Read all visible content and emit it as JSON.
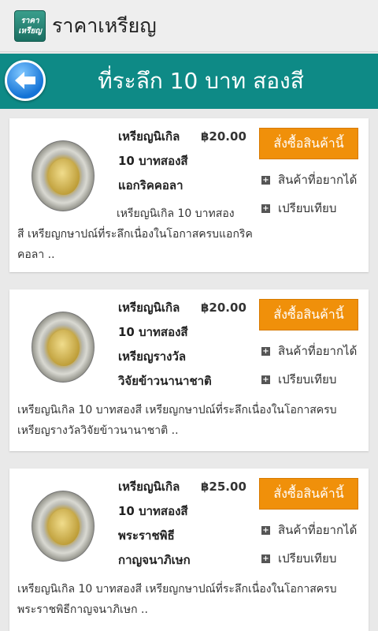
{
  "app": {
    "logo_line1": "ราคา",
    "logo_line2": "เหรียญ",
    "title": "ราคาเหรียญ"
  },
  "header": {
    "back_icon": "back-arrow-icon",
    "title": "ที่ระลึก 10 บาท สองสี"
  },
  "colors": {
    "header_bg": "#0e8a86",
    "order_button": "#f0900a"
  },
  "products": [
    {
      "name_lines": [
        "เหรียญนิเกิล",
        "10 บาทสองสี",
        "แอกริคคอลา"
      ],
      "price": "฿20.00",
      "order_label": "สั่งซื้อสินค้านี้",
      "wishlist_label": "สินค้าที่อยากได้",
      "compare_label": "เปรียบเทียบ",
      "desc_line1": "เหรียญนิเกิล 10 บาทสอง",
      "desc_line2": "สี เหรียญกษาปณ์ที่ระลึกเนื่องในโอกาสครบแอกริค",
      "desc_line3": "คอลา .."
    },
    {
      "name_lines": [
        "เหรียญนิเกิล",
        "10 บาทสองสี",
        "เหรียญรางวัล",
        "วิจัยข้าวนานาชาติ"
      ],
      "price": "฿20.00",
      "order_label": "สั่งซื้อสินค้านี้",
      "wishlist_label": "สินค้าที่อยากได้",
      "compare_label": "เปรียบเทียบ",
      "desc_line1": "เหรียญนิเกิล 10 บาทสองสี เหรียญกษาปณ์ที่ระลึกเนื่องในโอกาสครบ",
      "desc_line2": "เหรียญรางวัลวิจัยข้าวนานาชาติ .."
    },
    {
      "name_lines": [
        "เหรียญนิเกิล",
        "10 บาทสองสี",
        "พระราชพิธี",
        "กาญจนาภิเษก"
      ],
      "price": "฿25.00",
      "order_label": "สั่งซื้อสินค้านี้",
      "wishlist_label": "สินค้าที่อยากได้",
      "compare_label": "เปรียบเทียบ",
      "desc_line1": "เหรียญนิเกิล 10 บาทสองสี เหรียญกษาปณ์ที่ระลึกเนื่องในโอกาสครบ",
      "desc_line2": "พระราชพิธีกาญจนาภิเษก .."
    }
  ]
}
